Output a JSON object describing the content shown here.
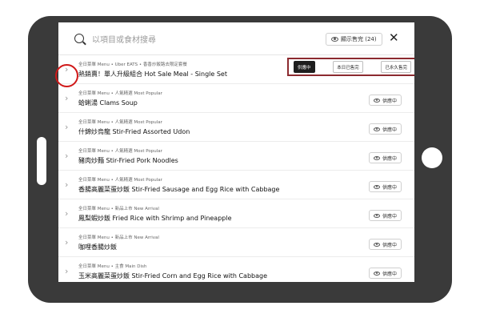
{
  "search": {
    "placeholder": "以項目或食材搜尋",
    "sold_out_toggle": "顯示售完 (24)"
  },
  "status_options": [
    "供應中",
    "本日已售完",
    "已永久售完"
  ],
  "items": [
    {
      "breadcrumb": "全日菜單 Menu • Uber EATS • 香香炒飯路去限定套餐",
      "name": "熱銷賣！單人升級組合 Hot Sale Meal - Single Set",
      "status": "供應中"
    },
    {
      "breadcrumb": "全日菜單 Menu • 人氣精選 Most Popular",
      "name": "蛤蜊湯 Clams Soup",
      "status": "供應中"
    },
    {
      "breadcrumb": "全日菜單 Menu • 人氣精選 Most Popular",
      "name": "什錦炒烏龍 Stir-Fried Assorted Udon",
      "status": "供應中"
    },
    {
      "breadcrumb": "全日菜單 Menu • 人氣精選 Most Popular",
      "name": "豬肉炒麵 Stir-Fried Pork Noodles",
      "status": "供應中"
    },
    {
      "breadcrumb": "全日菜單 Menu • 人氣精選 Most Popular",
      "name": "香腸高麗菜蛋炒飯 Stir-Fried Sausage and Egg Rice with Cabbage",
      "status": "供應中"
    },
    {
      "breadcrumb": "全日菜單 Menu • 新品上市 New Arrival",
      "name": "鳳梨蝦炒飯 Fried Rice with Shrimp and Pineapple",
      "status": "供應中"
    },
    {
      "breadcrumb": "全日菜單 Menu • 新品上市 New Arrival",
      "name": "咖哩香腸炒飯",
      "status": "供應中"
    },
    {
      "breadcrumb": "全日菜單 Menu • 主食 Main Dish",
      "name": "玉米高麗菜蛋炒飯 Stir-Fried Corn and Egg Rice with Cabbage",
      "status": "供應中"
    }
  ],
  "colors": {
    "tablet_frame": "#3a3a3a",
    "highlight_box": "#8c2a2f",
    "highlight_circle": "#d01818",
    "active_segment": "#1e1e1e"
  }
}
